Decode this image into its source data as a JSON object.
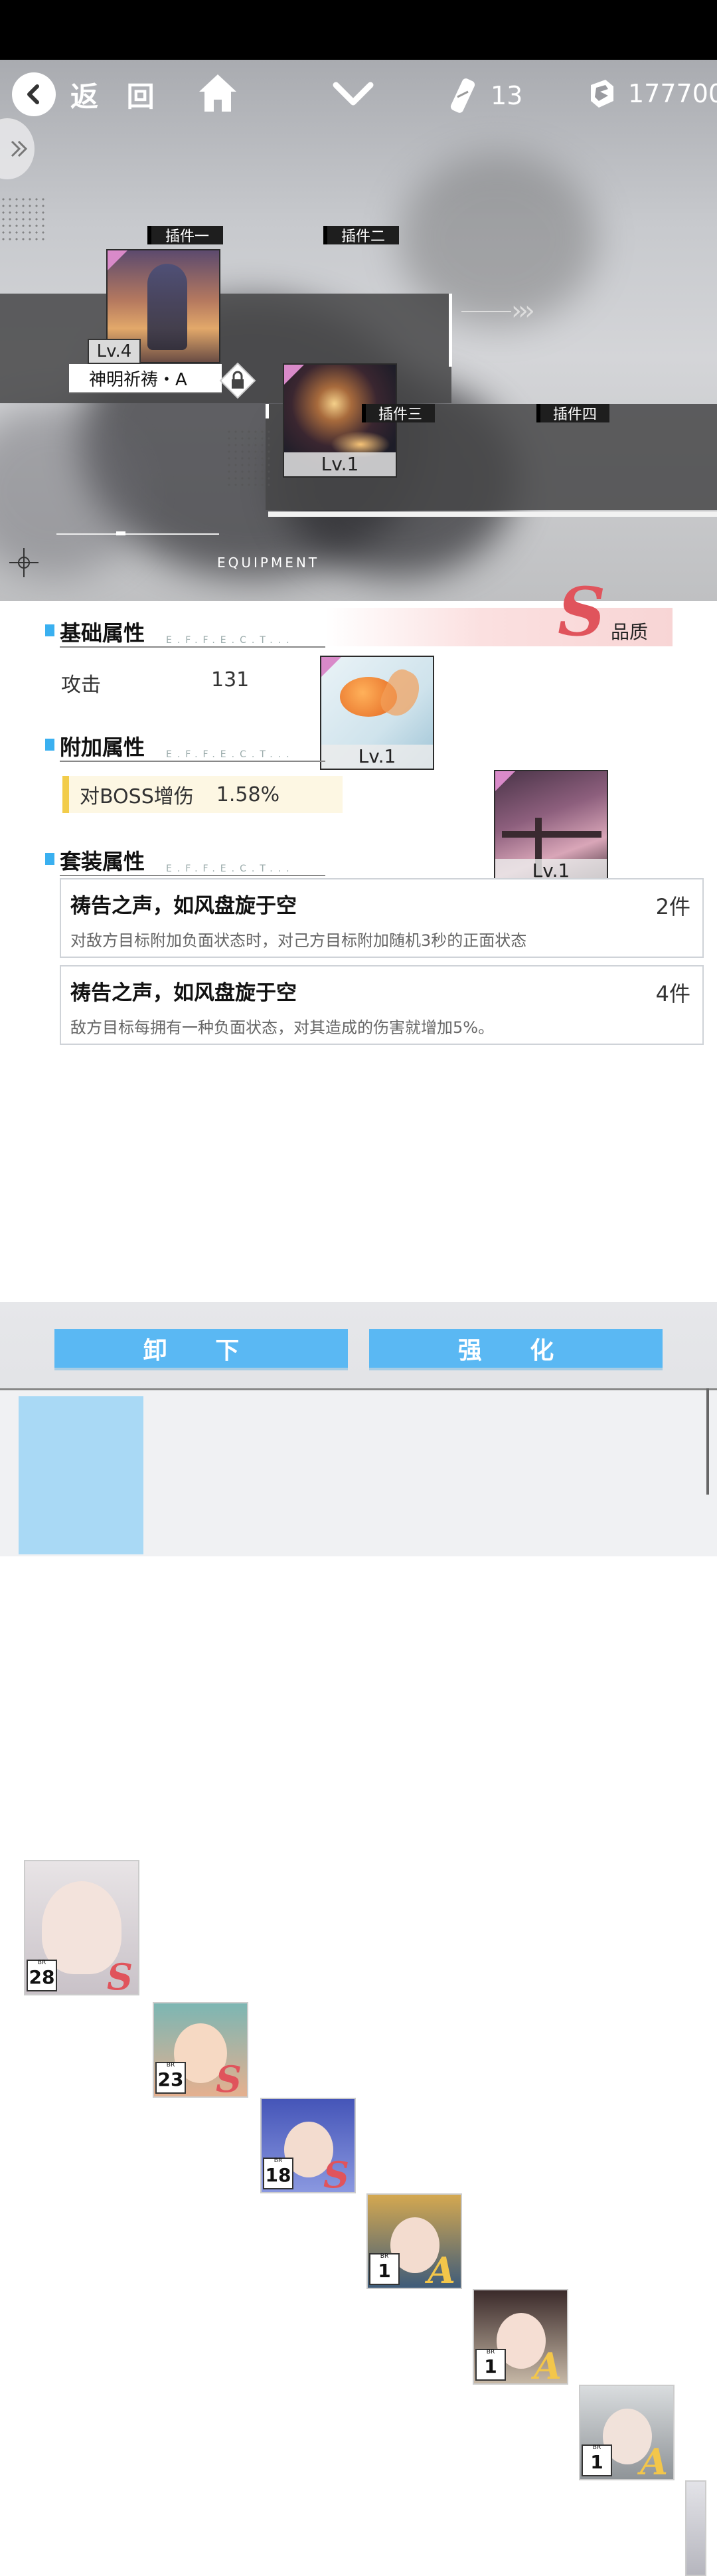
{
  "header": {
    "back_label": "返 回",
    "ticket_count": "13",
    "coin_count": "177700"
  },
  "slots": [
    {
      "label": "插件一",
      "level": "Lv.4",
      "name": "神明祈祷・A"
    },
    {
      "label": "插件二",
      "level": "Lv.1"
    },
    {
      "label": "插件三",
      "level": "Lv.1"
    },
    {
      "label": "插件四",
      "level": "Lv.1"
    }
  ],
  "scene": {
    "equipment_label": "EQUIPMENT",
    "arrows": "›››"
  },
  "quality": {
    "grade": "S",
    "label": "品质"
  },
  "basic": {
    "title": "基础属性",
    "effect_bg": "E.F.F.E.C.T...",
    "stat_name": "攻击",
    "stat_value": "131"
  },
  "extra": {
    "title": "附加属性",
    "effect_bg": "E.F.F.E.C.T...",
    "stat_name": "对BOSS增伤",
    "stat_value": "1.58%"
  },
  "set": {
    "title": "套装属性",
    "effect_bg": "E.F.F.E.C.T...",
    "items": [
      {
        "name": "祷告之声，如风盘旋于空",
        "count": "2件",
        "desc": "对敌方目标附加负面状态时，对己方目标附加随机3秒的正面状态"
      },
      {
        "name": "祷告之声，如风盘旋于空",
        "count": "4件",
        "desc": "敌方目标每拥有一种负面状态，对其造成的伤害就增加5%。"
      }
    ]
  },
  "buttons": {
    "unequip": "卸 下",
    "enhance": "强 化"
  },
  "characters": [
    {
      "br_label": "BR",
      "br": "28",
      "grade": "S",
      "selected": true
    },
    {
      "br_label": "BR",
      "br": "23",
      "grade": "S"
    },
    {
      "br_label": "BR",
      "br": "18",
      "grade": "S"
    },
    {
      "br_label": "BR",
      "br": "1",
      "grade": "A"
    },
    {
      "br_label": "BR",
      "br": "1",
      "grade": "A"
    },
    {
      "br_label": "BR",
      "br": "1",
      "grade": "A"
    }
  ],
  "colors": {
    "accent": "#5ab8f3",
    "grade_s": "#e0545c",
    "grade_a": "#f3c64a",
    "slot_corner": "#d98ac9"
  }
}
